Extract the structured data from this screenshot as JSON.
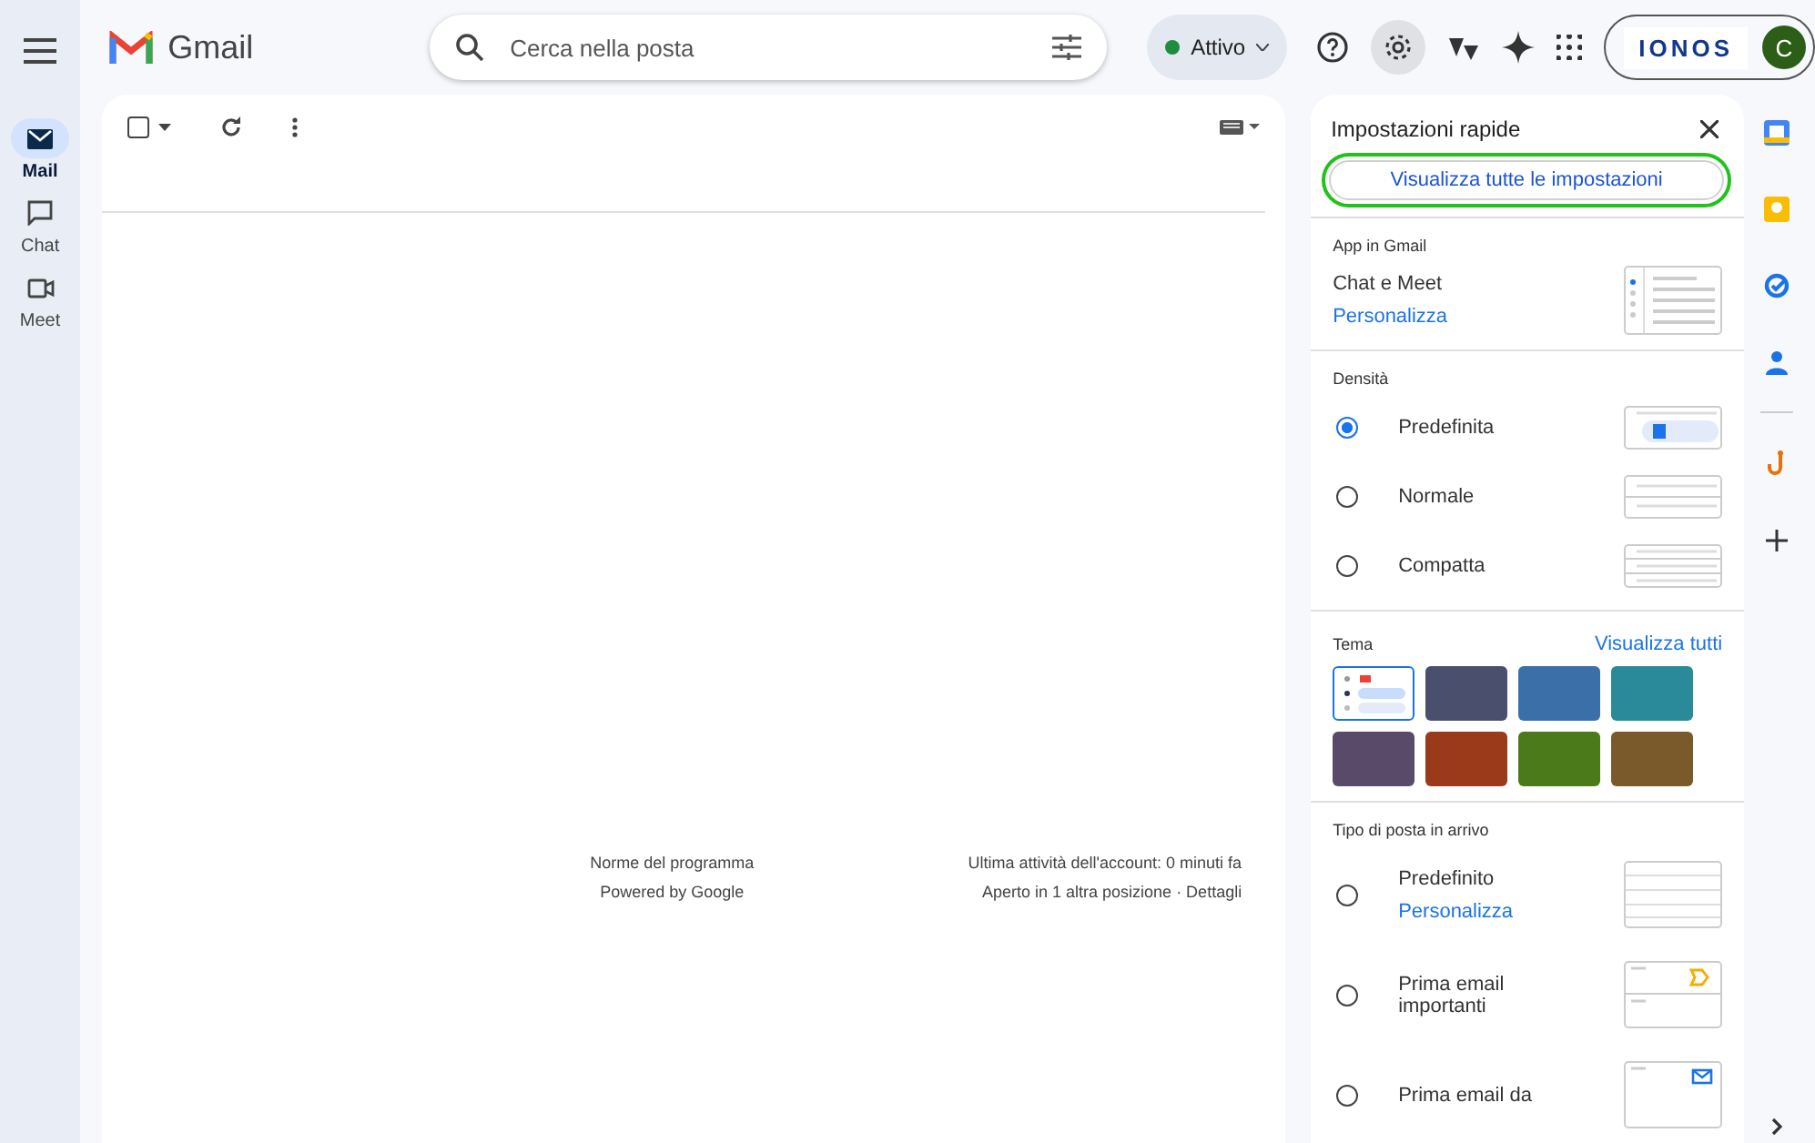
{
  "header": {
    "app_name": "Gmail",
    "search": {
      "placeholder": "Cerca nella posta"
    },
    "status": "Attivo",
    "account_brand": "IONOS",
    "avatar_letter": "C"
  },
  "rail": [
    {
      "label": "Mail",
      "selected": true
    },
    {
      "label": "Chat",
      "selected": false
    },
    {
      "label": "Meet",
      "selected": false
    }
  ],
  "toolbar": {
    "select_all_checked": false
  },
  "footer": {
    "left": [
      "Norme del programma",
      "Powered by Google"
    ],
    "right": [
      "Ultima attività dell'account: 0 minuti fa",
      "Aperto in 1 altra posizione · Dettagli"
    ]
  },
  "quick_settings": {
    "title": "Impostazioni rapide",
    "all_settings_button": "Visualizza tutte le impostazioni",
    "apps": {
      "heading": "App in Gmail",
      "label": "Chat e Meet",
      "link": "Personalizza"
    },
    "density": {
      "heading": "Densità",
      "options": [
        {
          "label": "Predefinita",
          "selected": true
        },
        {
          "label": "Normale",
          "selected": false
        },
        {
          "label": "Compatta",
          "selected": false
        }
      ]
    },
    "theme": {
      "heading": "Tema",
      "link": "Visualizza tutti",
      "tiles": [
        {
          "kind": "default",
          "selected": true
        },
        {
          "kind": "photo",
          "color": "#4a4f6e",
          "selected": false
        },
        {
          "kind": "photo",
          "color": "#3a6fa8",
          "selected": false
        },
        {
          "kind": "photo",
          "color": "#2a8a9a",
          "selected": false
        },
        {
          "kind": "photo",
          "color": "#5a4a6a",
          "selected": false
        },
        {
          "kind": "photo",
          "color": "#9a3a1a",
          "selected": false
        },
        {
          "kind": "photo",
          "color": "#4a7a1a",
          "selected": false
        },
        {
          "kind": "photo",
          "color": "#7a5a2a",
          "selected": false
        }
      ]
    },
    "inbox_type": {
      "heading": "Tipo di posta in arrivo",
      "options": [
        {
          "label": "Predefinito",
          "link": "Personalizza",
          "selected": false
        },
        {
          "label": "Prima email importanti",
          "selected": false
        },
        {
          "label": "Prima email da",
          "selected": false
        }
      ]
    }
  }
}
